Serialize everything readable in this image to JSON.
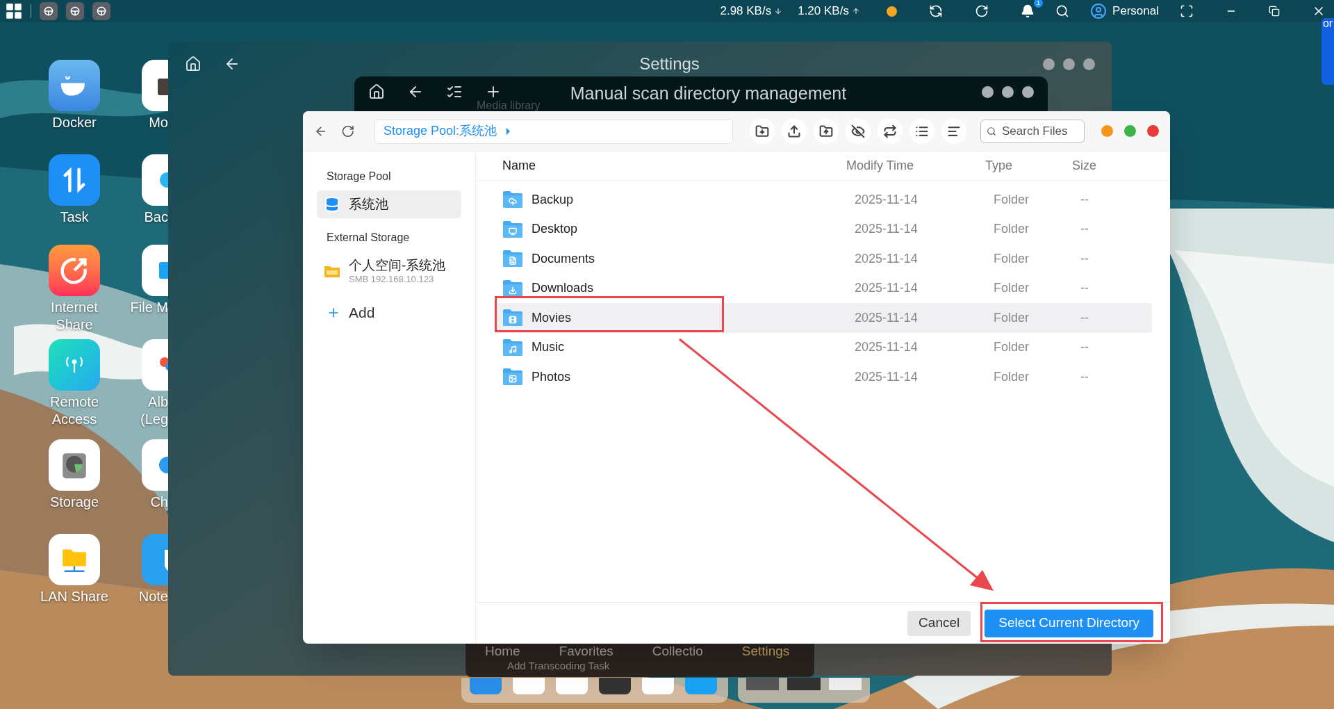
{
  "taskbar": {
    "download_speed": "2.98 KB/s",
    "upload_speed": "1.20 KB/s",
    "notification_count": "1",
    "user": "Personal",
    "edge_text": "or"
  },
  "desktop_icons": [
    {
      "label": "Docker",
      "kind": "docker"
    },
    {
      "label": "Task",
      "kind": "task"
    },
    {
      "label": "Internet Share",
      "kind": "share"
    },
    {
      "label": "Remote Access",
      "kind": "remote"
    },
    {
      "label": "Storage",
      "kind": "storage"
    },
    {
      "label": "LAN Share",
      "kind": "lan"
    }
  ],
  "desktop_icons_partial": [
    {
      "label": "Mo",
      "kind": "video"
    },
    {
      "label": "Bac",
      "kind": "cloud"
    },
    {
      "label": "File M",
      "kind": "files"
    },
    {
      "label": "Alb (Leg",
      "kind": "photos"
    },
    {
      "label": "Ch",
      "kind": "chat"
    },
    {
      "label": "Note",
      "kind": "note"
    }
  ],
  "settings_window": {
    "title": "Settings"
  },
  "scan_window": {
    "title": "Manual scan directory management",
    "section_label": "Media library",
    "bottom_tabs": [
      {
        "label": "Home",
        "selected": false
      },
      {
        "label": "Favorites",
        "selected": false
      },
      {
        "label": "Collectio",
        "selected": false
      },
      {
        "label": "Settings",
        "selected": true
      }
    ],
    "task_button": "Add Transcoding Task"
  },
  "file_dialog": {
    "path": "Storage Pool:系统池",
    "search": {
      "placeholder": "Search Files"
    },
    "sidebar": [
      {
        "heading": "Storage Pool",
        "items": [
          {
            "name": "系统池",
            "kind": "pool",
            "selected": true
          }
        ]
      },
      {
        "heading": "External Storage",
        "items": [
          {
            "name": "个人空间-系统池",
            "detail": "SMB 192.168.10.123",
            "kind": "smb",
            "selected": false
          }
        ]
      }
    ],
    "add_label": "Add",
    "columns": [
      "Name",
      "Modify Time",
      "Type",
      "Size"
    ],
    "rows": [
      {
        "name": "Backup",
        "kind": "backup",
        "modified": "2025-11-14",
        "type": "Folder",
        "size": "--",
        "selected": false
      },
      {
        "name": "Desktop",
        "kind": "desktop",
        "modified": "2025-11-14",
        "type": "Folder",
        "size": "--",
        "selected": false
      },
      {
        "name": "Documents",
        "kind": "documents",
        "modified": "2025-11-14",
        "type": "Folder",
        "size": "--",
        "selected": false
      },
      {
        "name": "Downloads",
        "kind": "downloads",
        "modified": "2025-11-14",
        "type": "Folder",
        "size": "--",
        "selected": false
      },
      {
        "name": "Movies",
        "kind": "movies",
        "modified": "2025-11-14",
        "type": "Folder",
        "size": "--",
        "selected": true
      },
      {
        "name": "Music",
        "kind": "music",
        "modified": "2025-11-14",
        "type": "Folder",
        "size": "--",
        "selected": false
      },
      {
        "name": "Photos",
        "kind": "photos",
        "modified": "2025-11-14",
        "type": "Folder",
        "size": "--",
        "selected": false
      }
    ],
    "buttons": {
      "cancel": "Cancel",
      "confirm": "Select Current Directory"
    }
  }
}
